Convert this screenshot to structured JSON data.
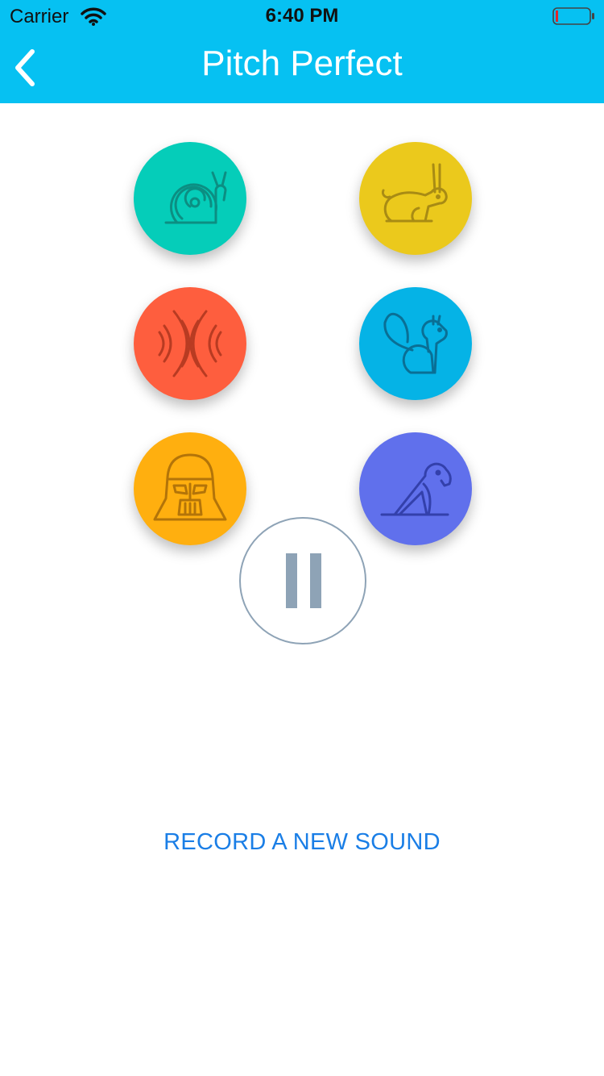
{
  "status_bar": {
    "carrier": "Carrier",
    "time": "6:40 PM",
    "wifi_icon": "wifi-icon",
    "battery_icon": "battery-low-icon"
  },
  "nav": {
    "back_icon": "chevron-left-icon",
    "title": "Pitch Perfect",
    "background_color": "#06c1f2"
  },
  "effects": [
    {
      "name": "snail",
      "icon": "snail-icon",
      "color": "#05cdb9"
    },
    {
      "name": "rabbit",
      "icon": "rabbit-icon",
      "color": "#ebc91c"
    },
    {
      "name": "echo",
      "icon": "echo-icon",
      "color": "#fe5e3e"
    },
    {
      "name": "chipmunk",
      "icon": "chipmunk-icon",
      "color": "#05b3e6"
    },
    {
      "name": "vader",
      "icon": "vader-icon",
      "color": "#ffaf0f"
    },
    {
      "name": "parrot",
      "icon": "parrot-icon",
      "color": "#6070ec"
    }
  ],
  "stop_button": {
    "icon": "pause-icon",
    "color": "#8ea3b6"
  },
  "record_link": {
    "label": "RECORD A NEW SOUND",
    "color": "#1a7ee6"
  }
}
